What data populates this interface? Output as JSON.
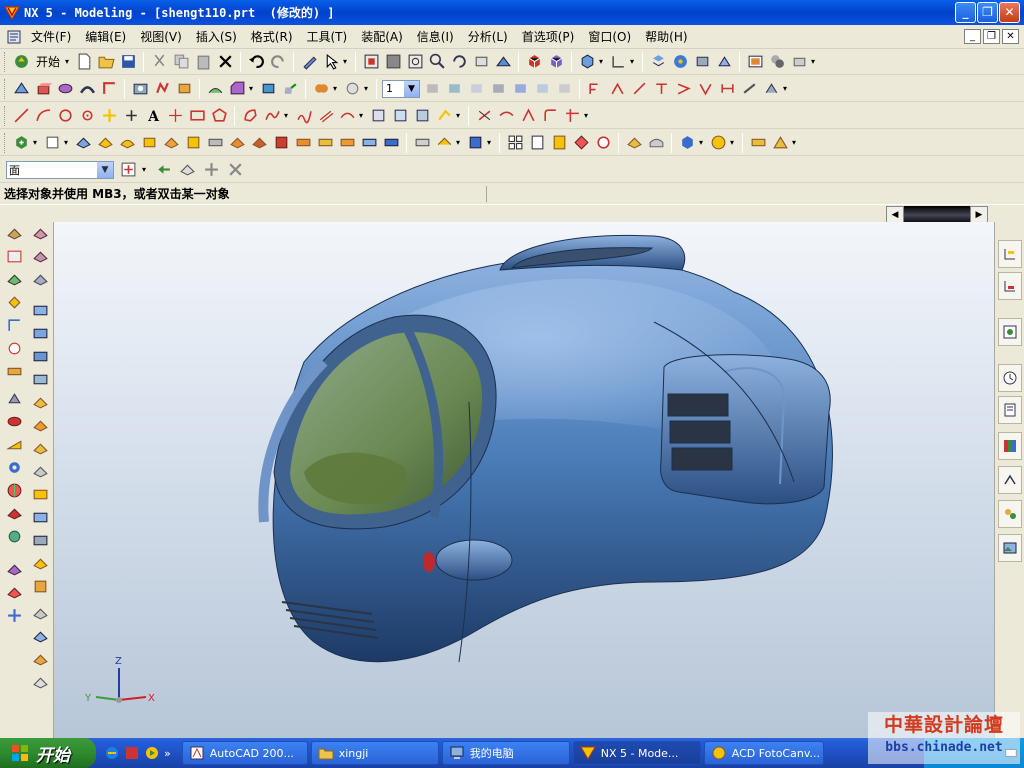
{
  "window": {
    "title": "NX 5 - Modeling - [shengt110.prt  (修改的) ]",
    "minimize": "_",
    "maximize": "❐",
    "close": "✕"
  },
  "menu": {
    "items": [
      "文件(F)",
      "编辑(E)",
      "视图(V)",
      "插入(S)",
      "格式(R)",
      "工具(T)",
      "装配(A)",
      "信息(I)",
      "分析(L)",
      "首选项(P)",
      "窗口(O)",
      "帮助(H)"
    ],
    "mdi_min": "_",
    "mdi_restore": "❐",
    "mdi_close": "✕"
  },
  "toolbar": {
    "start_label": "开始",
    "layer_value": "1"
  },
  "selection": {
    "filter_value": "面"
  },
  "cue_line": "选择对象并使用 MB3，或者双击某一对象",
  "triad": {
    "x": "X",
    "y": "Y",
    "z": "Z"
  },
  "taskbar": {
    "start": "开始",
    "tasks": [
      {
        "label": "AutoCAD 200..."
      },
      {
        "label": "xingji"
      },
      {
        "label": "我的电脑"
      },
      {
        "label": "NX 5 - Mode..."
      },
      {
        "label": "ACD FotoCanv..."
      }
    ]
  },
  "watermark": {
    "line1": "中華設計論壇",
    "line2": "bbs.chinade.net"
  },
  "colors": {
    "model_body": "#4a7cb8",
    "canopy_glass": "#6e8c4a",
    "viewport_top": "#f3f6fa",
    "viewport_bottom": "#b7c6d8",
    "xp_title_blue": "#0042cc"
  }
}
